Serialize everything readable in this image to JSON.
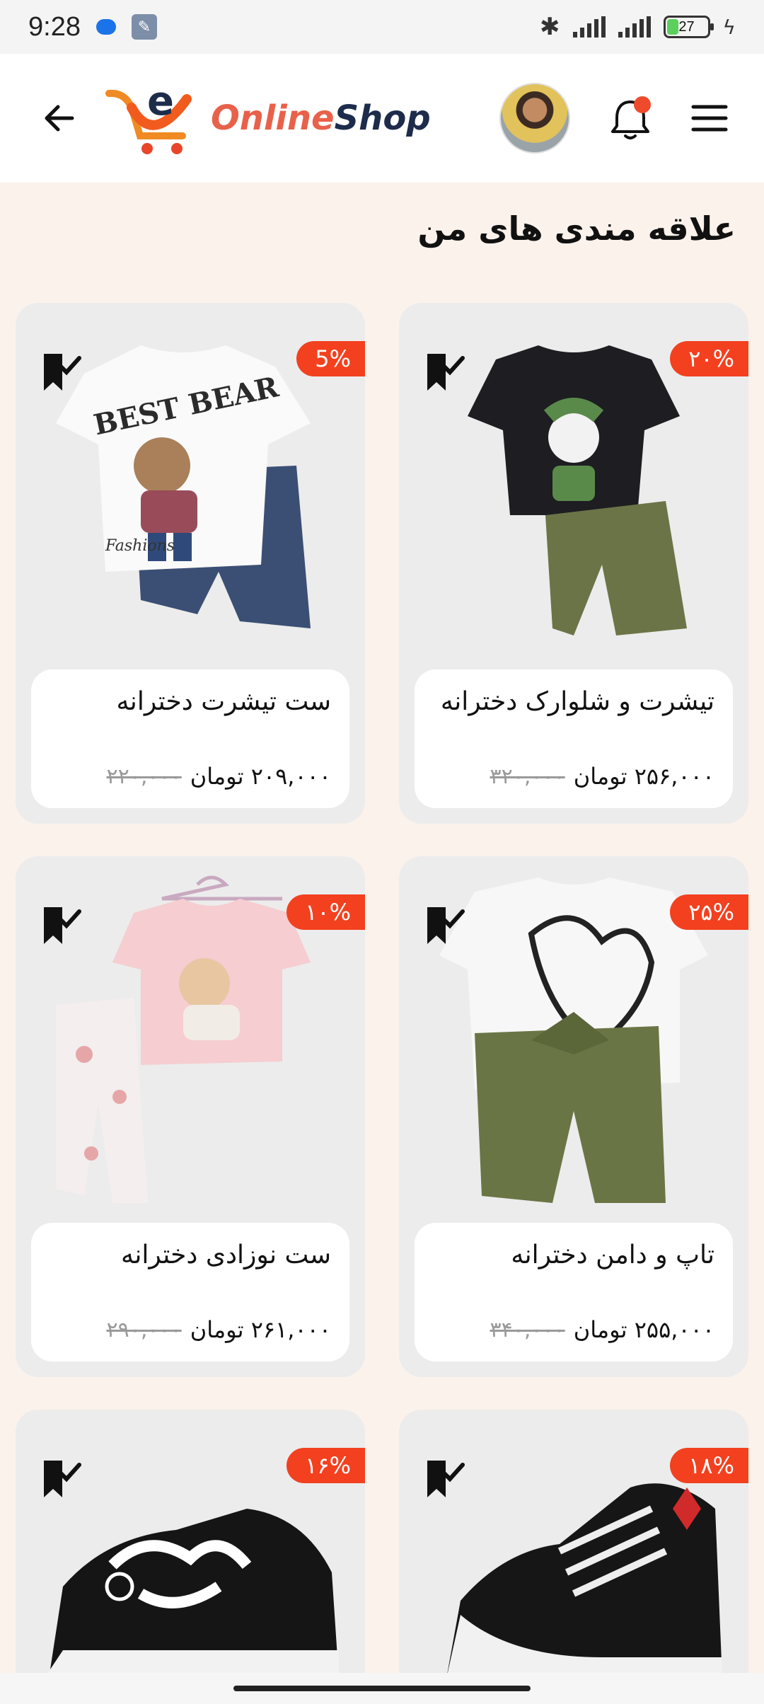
{
  "status_bar": {
    "time": "9:28",
    "battery_level": "27",
    "battery_fraction": 0.27
  },
  "header": {
    "logo_text_a": "Online",
    "logo_text_b": "Shop",
    "back_icon": "arrow-left-icon",
    "menu_icon": "hamburger-icon",
    "bell_icon": "bell-icon",
    "notification_dot_color": "#f04a2c"
  },
  "page": {
    "title": "علاقه مندی های من"
  },
  "colors": {
    "accent": "#f3401f",
    "background": "#fbf2ec",
    "card": "#ececec"
  },
  "products": [
    {
      "name": "تیشرت و شلوارک دخترانه",
      "discount": "۲۰%",
      "old_price": "۳۲۰,۰۰۰",
      "new_price": "۲۵۶,۰۰۰ تومان",
      "image": "black-tshirt-green-shorts"
    },
    {
      "name": "ست تیشرت دخترانه",
      "discount": "5%",
      "old_price": "۲۲۰,۰۰۰",
      "new_price": "۲۰۹,۰۰۰ تومان",
      "image": "white-bear-tshirt-denim-shorts"
    },
    {
      "name": "تاپ و دامن دخترانه",
      "discount": "۲۵%",
      "old_price": "۳۴۰,۰۰۰",
      "new_price": "۲۵۵,۰۰۰ تومان",
      "image": "white-heart-tshirt-olive-skirt"
    },
    {
      "name": "ست نوزادی دخترانه",
      "discount": "۱۰%",
      "old_price": "۲۹۰,۰۰۰",
      "new_price": "۲۶۱,۰۰۰ تومان",
      "image": "pink-unicorn-tshirt-floral-pants"
    },
    {
      "name": "",
      "discount": "۱۸%",
      "old_price": "",
      "new_price": "",
      "image": "black-high-top-sneaker"
    },
    {
      "name": "",
      "discount": "۱۶%",
      "old_price": "",
      "new_price": "",
      "image": "black-low-sneaker-white-laces"
    }
  ]
}
